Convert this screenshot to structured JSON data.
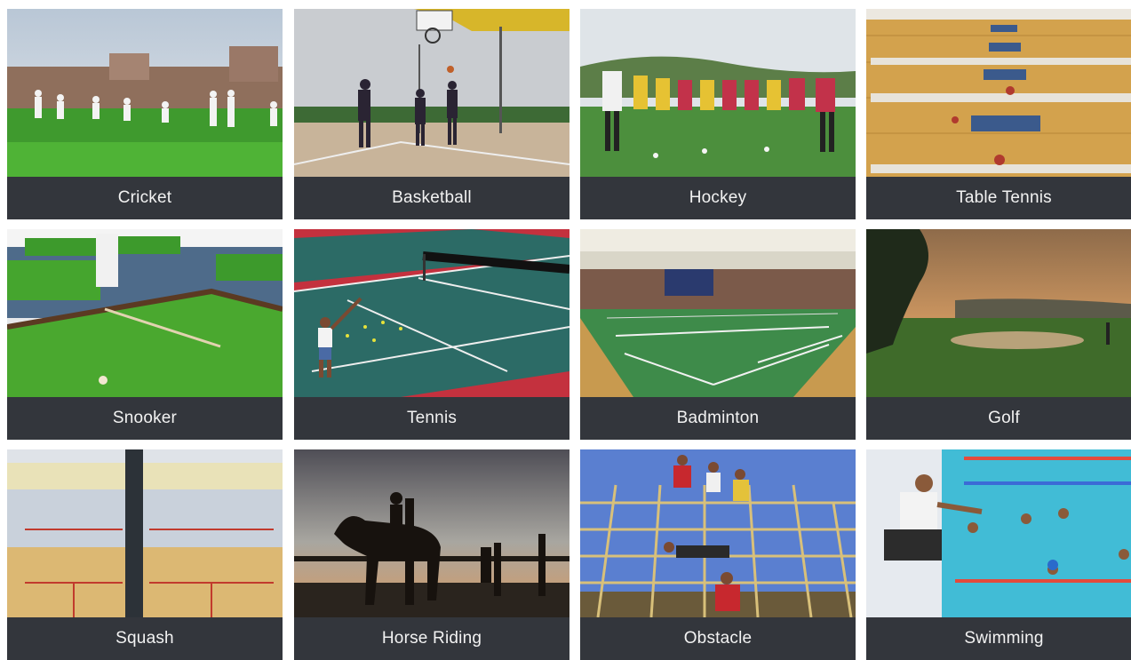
{
  "tiles": [
    {
      "label": "Cricket",
      "icon": "cricket-photo"
    },
    {
      "label": "Basketball",
      "icon": "basketball-photo"
    },
    {
      "label": "Hockey",
      "icon": "hockey-photo"
    },
    {
      "label": "Table Tennis",
      "icon": "table-tennis-photo"
    },
    {
      "label": "Snooker",
      "icon": "snooker-photo"
    },
    {
      "label": "Tennis",
      "icon": "tennis-photo"
    },
    {
      "label": "Badminton",
      "icon": "badminton-photo"
    },
    {
      "label": "Golf",
      "icon": "golf-photo"
    },
    {
      "label": "Squash",
      "icon": "squash-photo"
    },
    {
      "label": "Horse Riding",
      "icon": "horse-riding-photo"
    },
    {
      "label": "Obstacle",
      "icon": "obstacle-photo"
    },
    {
      "label": "Swimming",
      "icon": "swimming-photo"
    }
  ],
  "colors": {
    "caption_bg": "#33363c",
    "caption_text": "#f2f2f2"
  }
}
